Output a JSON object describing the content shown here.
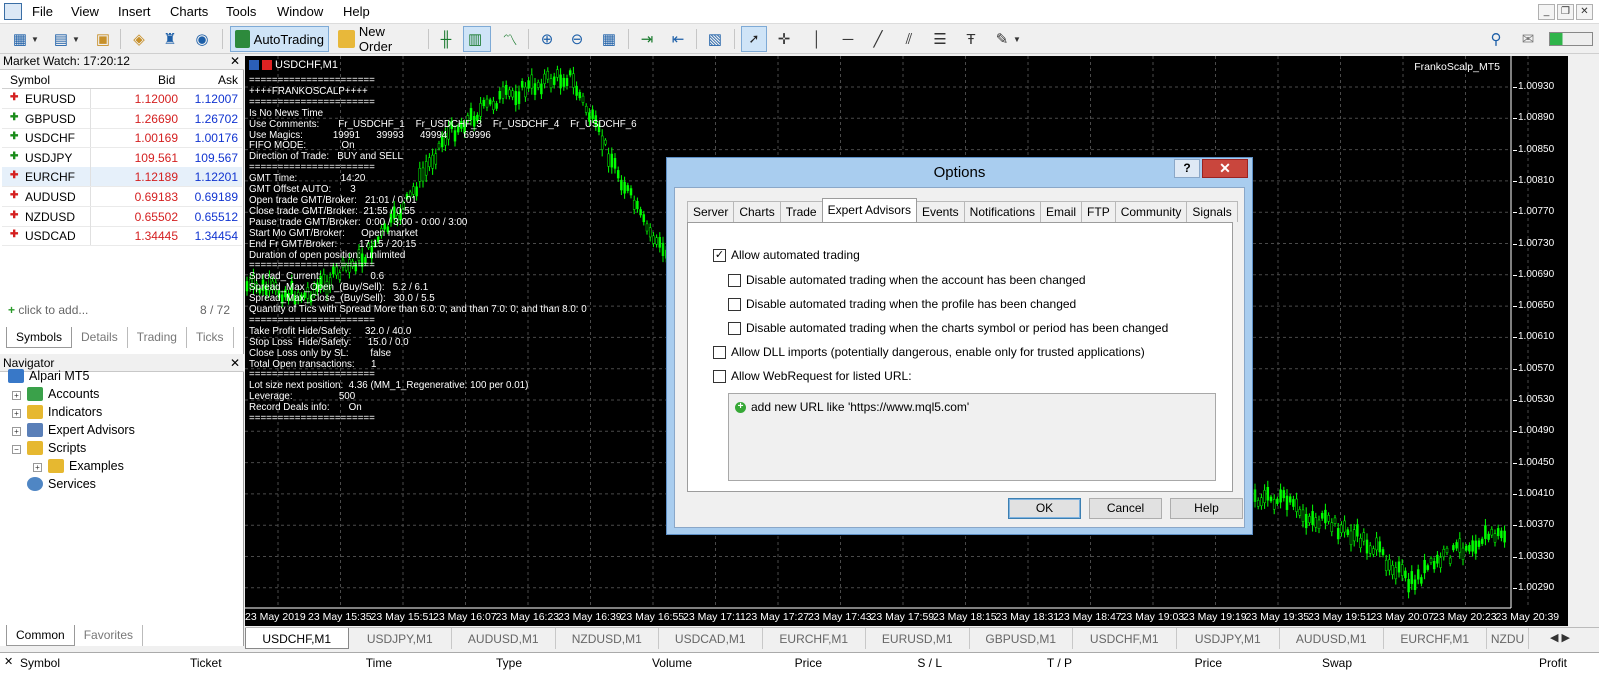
{
  "app": {
    "menu": [
      "File",
      "View",
      "Insert",
      "Charts",
      "Tools",
      "Window",
      "Help"
    ]
  },
  "toolbar": {
    "autotrading": "AutoTrading",
    "new_order": "New Order"
  },
  "market_watch": {
    "title": "Market Watch: 17:20:12",
    "headers": {
      "symbol": "Symbol",
      "bid": "Bid",
      "ask": "Ask"
    },
    "rows": [
      {
        "symbol": "EURUSD",
        "bid": "1.12000",
        "ask": "1.12007",
        "dir": "down"
      },
      {
        "symbol": "GBPUSD",
        "bid": "1.26690",
        "ask": "1.26702",
        "dir": "up"
      },
      {
        "symbol": "USDCHF",
        "bid": "1.00169",
        "ask": "1.00176",
        "dir": "up"
      },
      {
        "symbol": "USDJPY",
        "bid": "109.561",
        "ask": "109.567",
        "dir": "up"
      },
      {
        "symbol": "EURCHF",
        "bid": "1.12189",
        "ask": "1.12201",
        "dir": "down"
      },
      {
        "symbol": "AUDUSD",
        "bid": "0.69183",
        "ask": "0.69189",
        "dir": "down"
      },
      {
        "symbol": "NZDUSD",
        "bid": "0.65502",
        "ask": "0.65512",
        "dir": "down"
      },
      {
        "symbol": "USDCAD",
        "bid": "1.34445",
        "ask": "1.34454",
        "dir": "down"
      }
    ],
    "add_label": "click to add...",
    "count": "8 / 72",
    "tabs": [
      "Symbols",
      "Details",
      "Trading",
      "Ticks"
    ]
  },
  "navigator": {
    "title": "Navigator",
    "root": "Alpari MT5",
    "items": [
      "Accounts",
      "Indicators",
      "Expert Advisors",
      "Scripts",
      "Examples",
      "Services"
    ],
    "tabs": [
      "Common",
      "Favorites"
    ]
  },
  "chart": {
    "title": "USDCHF,M1",
    "ea_name": "FrankoScalp_MT5",
    "price_labels": [
      "1.00930",
      "1.00890",
      "1.00850",
      "1.00810",
      "1.00770",
      "1.00730",
      "1.00690",
      "1.00650",
      "1.00610",
      "1.00570",
      "1.00530",
      "1.00490",
      "1.00450",
      "1.00410",
      "1.00370",
      "1.00330",
      "1.00290"
    ],
    "time_labels": [
      "23 May 2019",
      "23 May 15:35",
      "23 May 15:51",
      "23 May 16:07",
      "23 May 16:23",
      "23 May 16:39",
      "23 May 16:55",
      "23 May 17:11",
      "23 May 17:27",
      "23 May 17:43",
      "23 May 17:59",
      "23 May 18:15",
      "23 May 18:31",
      "23 May 18:47",
      "23 May 19:03",
      "23 May 19:19",
      "23 May 19:35",
      "23 May 19:51",
      "23 May 20:07",
      "23 May 20:23",
      "23 May 20:39"
    ],
    "info_lines": [
      "======================",
      "++++FRANKOSCALP++++",
      "======================",
      "Is No News Time",
      "Use Comments:       Fr_USDCHF_1    Fr_USDCHF_3    Fr_USDCHF_4    Fr_USDCHF_6",
      "Use Magics:           19991      39993      49994      69996",
      "FIFO MODE:             On",
      "Direction of Trade:   BUY and SELL",
      "======================",
      "GMT Time:                14:20",
      "GMT Offset AUTO:       3",
      "Open trade GMT/Broker:   21:01 / 0:01",
      "Close trade GMT/Broker:  21:55 / 0:55",
      "Pause trade GMT/Broker:  0:00 / 3:00 - 0:00 / 3:00",
      "Start Mo GMT/Broker:      Open market",
      "End Fr GMT/Broker:        17:15 / 20:15",
      "Duration of open position:  unlimited",
      "======================",
      "Spread_Current:                  0.6",
      "Spread_Max_Open_(Buy/Sell):   5.2 / 6.1",
      "Spread_Max_Close_(Buy/Sell):   30.0 / 5.5",
      "Quantity of Tics with Spread More than 6.0: 0; and than 7.0: 0; and than 8.0: 0",
      "======================",
      "Take Profit Hide/Safety:     32.0 / 40.0",
      "Stop Loss  Hide/Safety:      15.0 / 0.0",
      "Close Loss only by SL:        false",
      "Total Open transactions:      1",
      "======================",
      "Lot size next position:  4.36 (MM_1_Regenerative: 100 per 0.01)",
      "Leverage:                 500",
      "Record Deals info:       On",
      "======================"
    ]
  },
  "chart_tabs": [
    "USDCHF,M1",
    "USDJPY,M1",
    "AUDUSD,M1",
    "NZDUSD,M1",
    "USDCAD,M1",
    "EURCHF,M1",
    "EURUSD,M1",
    "GBPUSD,M1",
    "USDCHF,M1",
    "USDJPY,M1",
    "AUDUSD,M1",
    "EURCHF,M1",
    "NZDU"
  ],
  "terminal": {
    "headers": [
      "Symbol",
      "Ticket",
      "Time",
      "Type",
      "Volume",
      "Price",
      "S / L",
      "T / P",
      "Price",
      "Swap",
      "Profit"
    ]
  },
  "options_dialog": {
    "title": "Options",
    "help": "?",
    "close": "✕",
    "tabs": [
      "Server",
      "Charts",
      "Trade",
      "Expert Advisors",
      "Events",
      "Notifications",
      "Email",
      "FTP",
      "Community",
      "Signals"
    ],
    "active_tab": "Expert Advisors",
    "checkboxes": [
      {
        "label": "Allow automated trading",
        "checked": true
      },
      {
        "label": "Disable automated trading when the account has been changed",
        "checked": false
      },
      {
        "label": "Disable automated trading when the profile has been changed",
        "checked": false
      },
      {
        "label": "Disable automated trading when the charts symbol or period has been changed",
        "checked": false
      },
      {
        "label": "Allow DLL imports (potentially dangerous, enable only for trusted applications)",
        "checked": false
      },
      {
        "label": "Allow WebRequest for listed URL:",
        "checked": false
      }
    ],
    "url_placeholder": "add new URL like 'https://www.mql5.com'",
    "buttons": {
      "ok": "OK",
      "cancel": "Cancel",
      "help": "Help"
    }
  },
  "colors": {
    "candle": "#00ff00",
    "chart_bg": "#000000",
    "grid": "#4a4a4a",
    "bid_up": "#d42020",
    "ask_blue": "#1034d0",
    "dialog_frame": "#a9cdef",
    "close_red": "#c9463d"
  }
}
